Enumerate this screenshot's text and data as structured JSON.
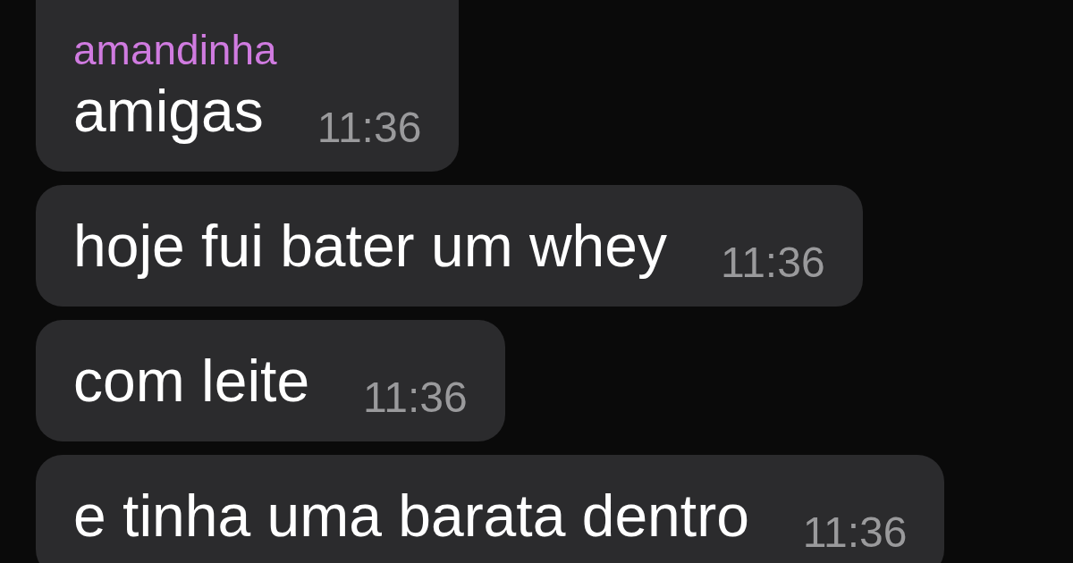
{
  "chat": {
    "messages": [
      {
        "sender": {
          "name": "amandinha",
          "color": "#d07be0"
        },
        "text": "amigas",
        "time": "11:36"
      },
      {
        "text": "hoje fui bater um whey",
        "time": "11:36"
      },
      {
        "text": "com leite",
        "time": "11:36"
      },
      {
        "text": "e tinha uma barata dentro",
        "time": "11:36"
      }
    ]
  }
}
